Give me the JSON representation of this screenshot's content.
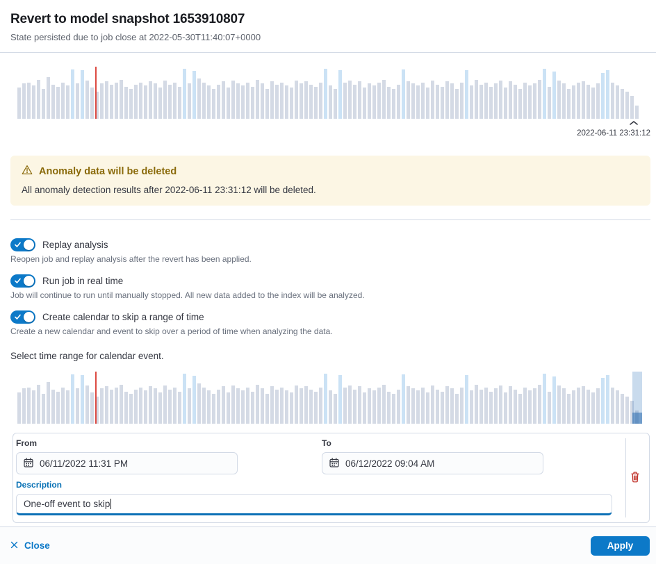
{
  "header": {
    "title": "Revert to model snapshot 1653910807",
    "subtitle": "State persisted due to job close at 2022-05-30T11:40:07+0000"
  },
  "snapshot_chart": {
    "timestamp": "2022-06-11 23:31:12"
  },
  "warning": {
    "title": "Anomaly data will be deleted",
    "body": "All anomaly detection results after 2022-06-11 23:31:12 will be deleted."
  },
  "toggles": [
    {
      "label": "Replay analysis",
      "help": "Reopen job and replay analysis after the revert has been applied.",
      "checked": true
    },
    {
      "label": "Run job in real time",
      "help": "Job will continue to run until manually stopped. All new data added to the index will be analyzed.",
      "checked": true
    },
    {
      "label": "Create calendar to skip a range of time",
      "help": "Create a new calendar and event to skip over a period of time when analyzing the data.",
      "checked": true
    }
  ],
  "calendar_section": {
    "prompt": "Select time range for calendar event."
  },
  "event_form": {
    "from": {
      "label": "From",
      "value": "06/11/2022 11:31 PM"
    },
    "to": {
      "label": "To",
      "value": "06/12/2022 09:04 AM"
    },
    "description": {
      "label": "Description",
      "value": "One-off event to skip"
    }
  },
  "footer": {
    "close_label": "Close",
    "apply_label": "Apply"
  },
  "colors": {
    "accent": "#0c79c8",
    "warning_bg": "#FCF6E4",
    "warning_text": "#8A6A0A",
    "danger": "#BD271E",
    "bar": "#D4DAE5",
    "bar_highlight": "#CBE2F5",
    "marker_line": "#DC4A42",
    "border": "#D3DAE6"
  },
  "chart_data": {
    "type": "bar",
    "title": "Job event rate with revert point marker",
    "values": [
      60,
      68,
      70,
      64,
      75,
      58,
      80,
      66,
      62,
      70,
      64,
      95,
      68,
      93,
      74,
      60,
      52,
      68,
      72,
      65,
      70,
      75,
      62,
      58,
      66,
      70,
      64,
      72,
      68,
      60,
      74,
      66,
      70,
      62,
      96,
      68,
      92,
      78,
      70,
      64,
      58,
      66,
      72,
      60,
      74,
      68,
      64,
      70,
      62,
      75,
      68,
      58,
      72,
      66,
      70,
      64,
      60,
      74,
      68,
      72,
      66,
      62,
      70,
      96,
      64,
      58,
      94,
      70,
      74,
      66,
      72,
      60,
      68,
      64,
      70,
      75,
      62,
      58,
      66,
      95,
      72,
      68,
      64,
      70,
      60,
      74,
      66,
      62,
      72,
      68,
      58,
      70,
      93,
      64,
      75,
      66,
      70,
      62,
      68,
      74,
      60,
      72,
      66,
      58,
      70,
      64,
      68,
      75,
      96,
      62,
      91,
      74,
      68,
      58,
      64,
      70,
      72,
      66,
      60,
      68,
      88,
      94,
      70,
      64,
      58,
      52,
      44,
      25
    ],
    "highlighted_indexes": [
      11,
      13,
      34,
      36,
      63,
      66,
      79,
      92,
      108,
      110,
      120,
      121
    ],
    "marker_index": 16,
    "selection": {
      "start_index": 126,
      "end_index": 127
    },
    "snapshot_time_label": "2022-06-11 23:31:12"
  }
}
